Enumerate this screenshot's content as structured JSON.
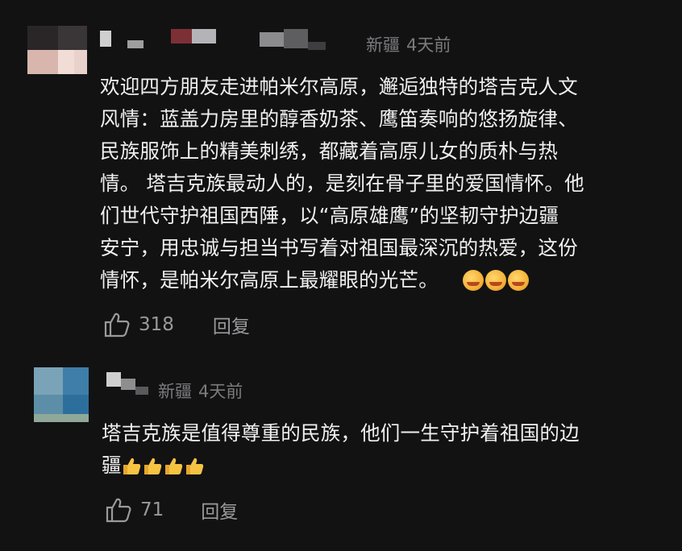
{
  "comments": [
    {
      "location": "新疆",
      "time": "4天前",
      "text_lines": [
        "欢迎四方朋友走进帕米尔高原，邂逅独特的塔吉克人文",
        "风情：蓝盖力房里的醇香奶茶、鹰笛奏响的悠扬旋律、",
        "民族服饰上的精美刺绣，都藏着高原儿女的质朴与热",
        "情。 塔吉克族最动人的，是刻在骨子里的爱国情怀。他",
        "们世代守护祖国西陲，以“高原雄鹰”的坚韧守护边疆",
        "安宁，用忠诚与担当书写着对祖国最深沉的热爱，这份",
        "情怀，是帕米尔高原上最耀眼的光芒。"
      ],
      "emojis": [
        "grin-emoji",
        "grin-emoji",
        "grin-emoji"
      ],
      "likes": "318",
      "reply_label": "回复"
    },
    {
      "location": "新疆",
      "time": "4天前",
      "text_lines": [
        "塔吉克族是值得尊重的民族，他们一生守护着祖国的边",
        "疆"
      ],
      "emojis": [
        "thumbs-up-emoji",
        "thumbs-up-emoji",
        "thumbs-up-emoji",
        "thumbs-up-emoji"
      ],
      "likes": "71",
      "reply_label": "回复"
    }
  ],
  "colors": {
    "background": "#121213",
    "text": "#f0f0f0",
    "meta": "#7b7b7d",
    "action": "#9a9a9c"
  }
}
